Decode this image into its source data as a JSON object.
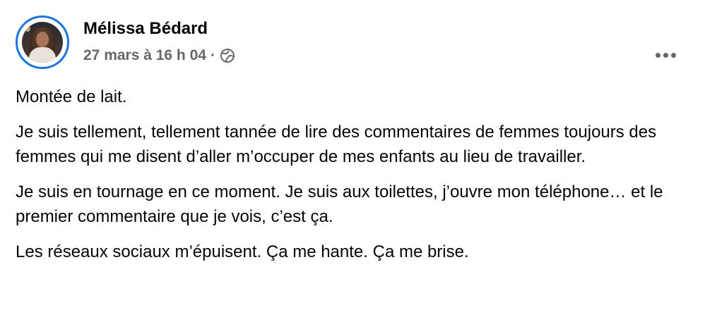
{
  "post": {
    "author_name": "Mélissa Bédard",
    "timestamp": "27 mars à 16 h 04",
    "separator": "·",
    "audience_icon": "globe-icon",
    "more_icon": "more-options-icon",
    "paragraphs": [
      "Montée de lait.",
      "Je suis tellement, tellement tannée de lire des commentaires de femmes toujours des femmes qui me disent d’aller m’occuper de mes enfants au lieu de travailler.",
      "Je suis en tournage en ce moment. Je suis aux toilettes, j’ouvre mon téléphone… et le premier commentaire que je vois, c’est ça.",
      "Les réseaux sociaux m’épuisent. Ça me hante. Ça me brise."
    ]
  },
  "colors": {
    "story_ring": "#1b74e4",
    "secondary_text": "#65676b",
    "primary_text": "#050505"
  }
}
